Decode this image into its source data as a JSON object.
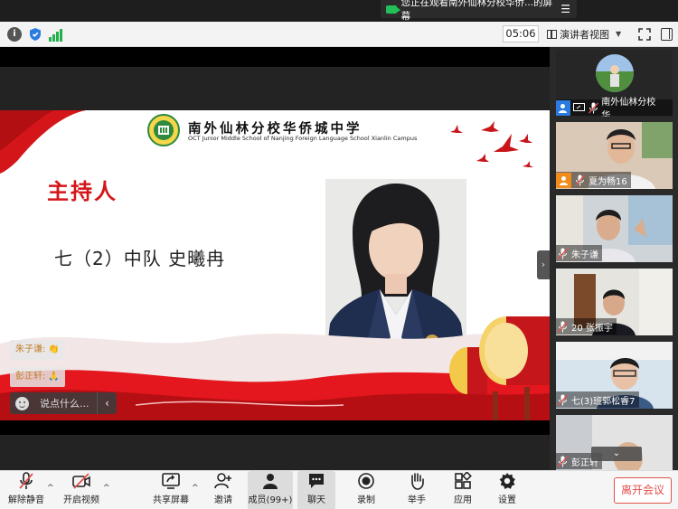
{
  "share_banner": {
    "text": "您正在观看南外仙林分校华侨...的屏幕",
    "menu": "☰"
  },
  "topbar": {
    "timer": "05:06",
    "view_label": "演讲者视图"
  },
  "slide": {
    "school_name_cn": "南外仙林分校华侨城中学",
    "school_name_en": "OCT Junior Middle School of Nanjing Foreign Language School Xianlin Campus",
    "title": "主持人",
    "host_text": "七（2）中队  史曦冉"
  },
  "chat": {
    "messages": [
      {
        "sender": "朱子谦:",
        "emoji": "👏"
      },
      {
        "sender": "彭正轩:",
        "emoji": "🙏"
      }
    ],
    "placeholder": "说点什么...",
    "send": "‹"
  },
  "collapse_handle": "›",
  "participants": [
    {
      "name": "南外仙林分校华...",
      "badge": "host"
    },
    {
      "name": "夏为畅16",
      "badge": "cohost"
    },
    {
      "name": "朱子谦",
      "badge": "none"
    },
    {
      "name": "20 张振宇",
      "badge": "none"
    },
    {
      "name": "七(3)班郭松睿7",
      "badge": "none"
    },
    {
      "name": "彭正轩",
      "badge": "none"
    }
  ],
  "scroll_down": "⌄",
  "bottombar": {
    "unmute": "解除静音",
    "start_video": "开启视频",
    "share_screen": "共享屏幕",
    "invite": "邀请",
    "members": "成员(99+)",
    "chat": "聊天",
    "record": "录制",
    "raise_hand": "举手",
    "apps": "应用",
    "settings": "设置",
    "leave": "离开会议",
    "caret": "^"
  },
  "colors": {
    "accent_red": "#d4161a",
    "leave_red": "#e0504b",
    "host_blue": "#2b7be0",
    "cohost_orange": "#f08c1c"
  }
}
